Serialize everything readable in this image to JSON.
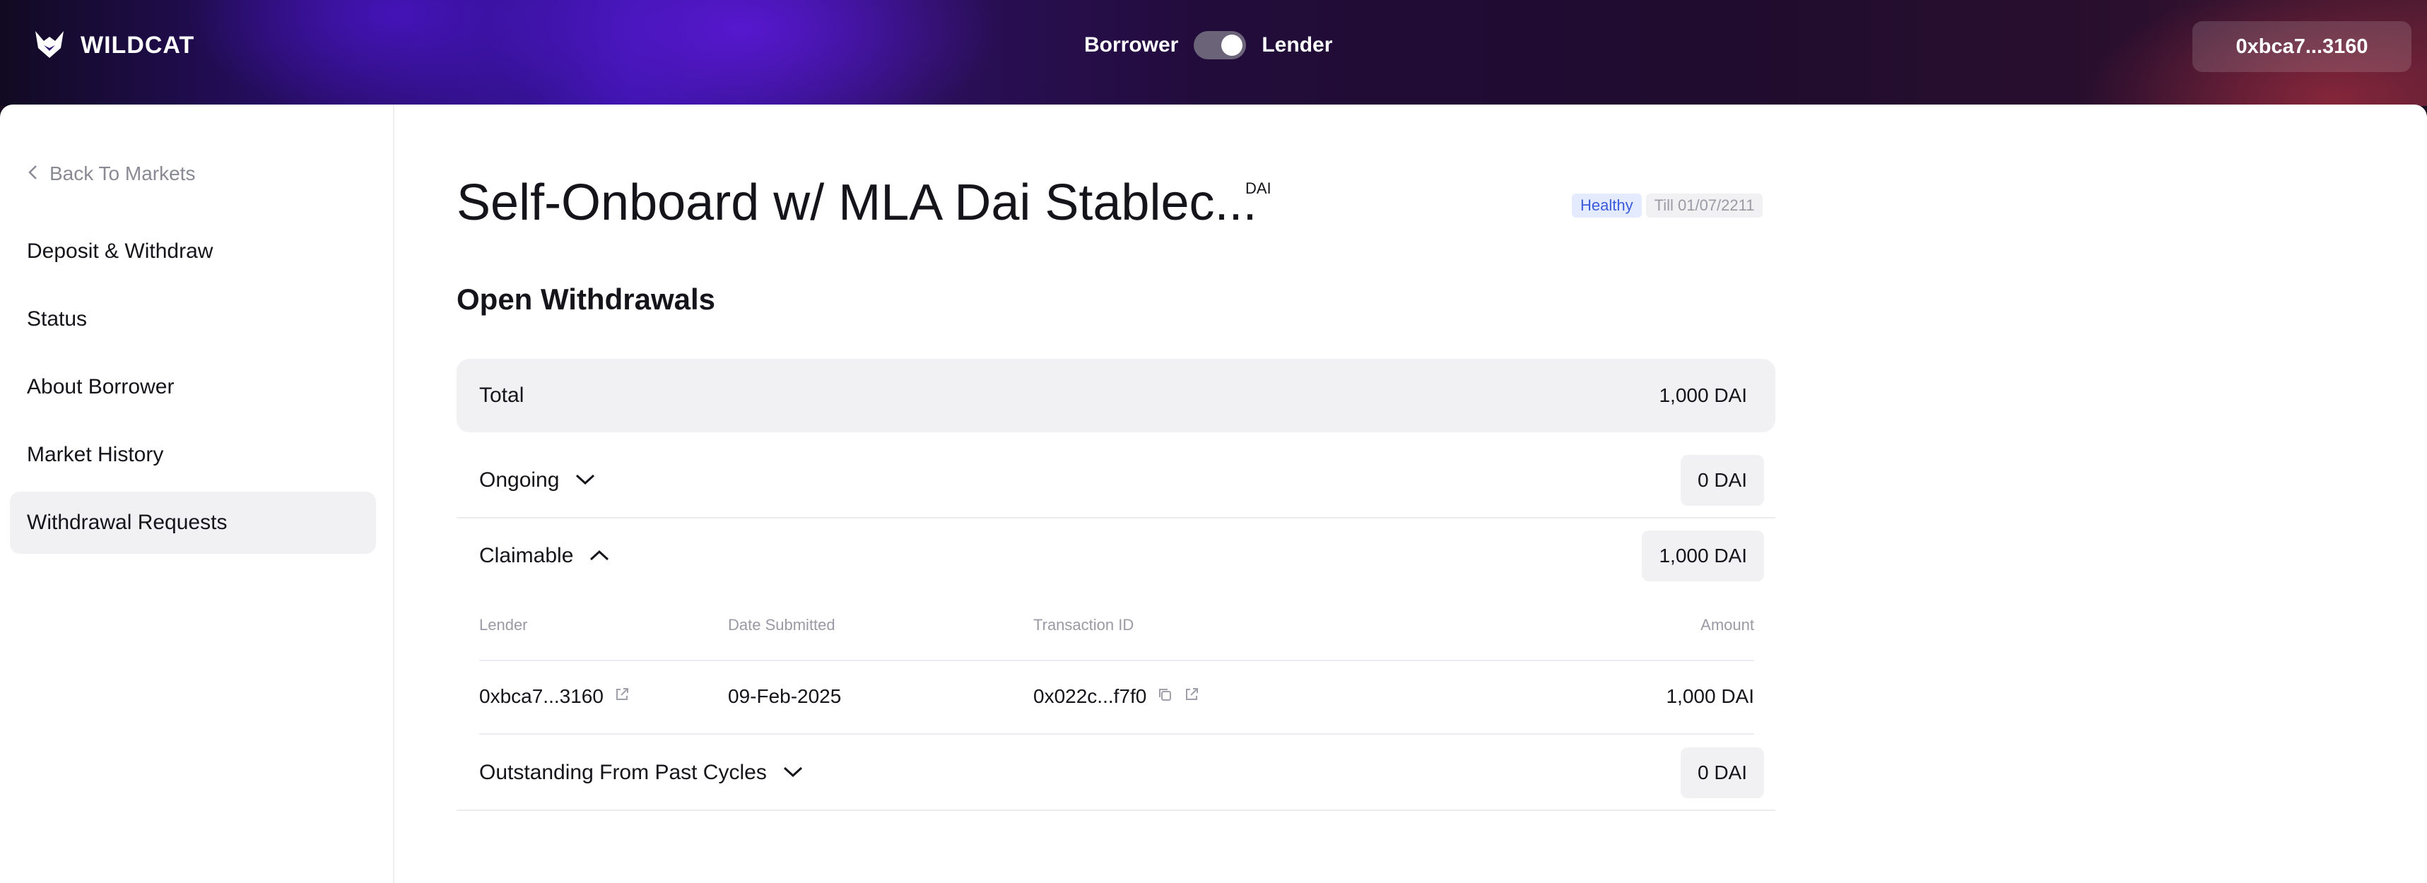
{
  "header": {
    "brand": "WILDCAT",
    "role_left": "Borrower",
    "role_right": "Lender",
    "wallet": "0xbca7...3160"
  },
  "sidebar": {
    "back_label": "Back To Markets",
    "items": [
      {
        "label": "Deposit & Withdraw"
      },
      {
        "label": "Status"
      },
      {
        "label": "About Borrower"
      },
      {
        "label": "Market History"
      },
      {
        "label": "Withdrawal Requests",
        "active": true
      }
    ]
  },
  "market": {
    "title": "Self-Onboard w/ MLA Dai Stablec...",
    "asset": "DAI",
    "status": "Healthy",
    "until": "Till 01/07/2211"
  },
  "withdrawals": {
    "section_title": "Open Withdrawals",
    "total_label": "Total",
    "total_value": "1,000 DAI",
    "ongoing_label": "Ongoing",
    "ongoing_value": "0 DAI",
    "claimable_label": "Claimable",
    "claimable_value": "1,000 DAI",
    "past_label": "Outstanding From Past Cycles",
    "past_value": "0 DAI",
    "table": {
      "columns": [
        "Lender",
        "Date Submitted",
        "Transaction ID",
        "Amount"
      ],
      "rows": [
        {
          "lender": "0xbca7...3160",
          "date": "09-Feb-2025",
          "tx": "0x022c...f7f0",
          "amount": "1,000 DAI"
        }
      ]
    }
  },
  "icons": {
    "logo": "wildcat-logo-icon",
    "back": "chevron-left-icon",
    "expand": "chevron-down-icon",
    "collapse": "chevron-up-icon",
    "external": "external-link-icon",
    "copy": "copy-icon"
  }
}
